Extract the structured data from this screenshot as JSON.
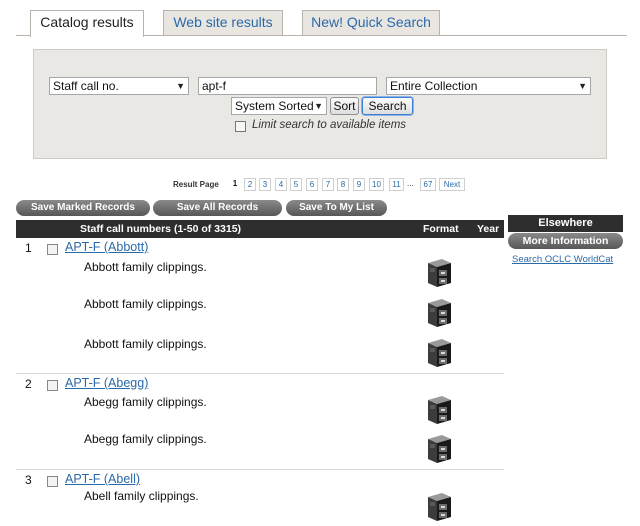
{
  "tabs": [
    {
      "label": "Catalog results"
    },
    {
      "label": "Web site results"
    },
    {
      "label": "New! Quick Search"
    }
  ],
  "search": {
    "field_select": "Staff call no.",
    "query": "apt-f",
    "collection_select": "Entire Collection",
    "sort_select": "System Sorted",
    "sort_button": "Sort",
    "search_button": "Search",
    "limit_label": "Limit search to available items"
  },
  "pager": {
    "label": "Result Page",
    "current": "1",
    "pages": [
      "2",
      "3",
      "4",
      "5",
      "6",
      "7",
      "8",
      "9",
      "10",
      "11"
    ],
    "ellipsis": "...",
    "last": "67",
    "next": "Next"
  },
  "actions": {
    "save_marked": "Save Marked Records",
    "save_all": "Save All Records",
    "save_list": "Save To My List"
  },
  "table": {
    "title": "Staff call numbers (1-50 of 3315)",
    "col_format": "Format",
    "col_year": "Year"
  },
  "sidebar": {
    "header": "Elsewhere",
    "more_info": "More Information",
    "link": "Search OCLC WorldCat"
  },
  "records": [
    {
      "num": "1",
      "title": "APT-F (Abbott)",
      "items": [
        "Abbott family clippings.",
        "Abbott family clippings.",
        "Abbott family clippings."
      ]
    },
    {
      "num": "2",
      "title": "APT-F (Abegg)",
      "items": [
        "Abegg family clippings.",
        "Abegg family clippings."
      ]
    },
    {
      "num": "3",
      "title": "APT-F (Abell)",
      "items": [
        "Abell family clippings."
      ]
    }
  ],
  "icons": {
    "format": "archive-box-icon",
    "dropdown": "chevron-down-icon"
  }
}
